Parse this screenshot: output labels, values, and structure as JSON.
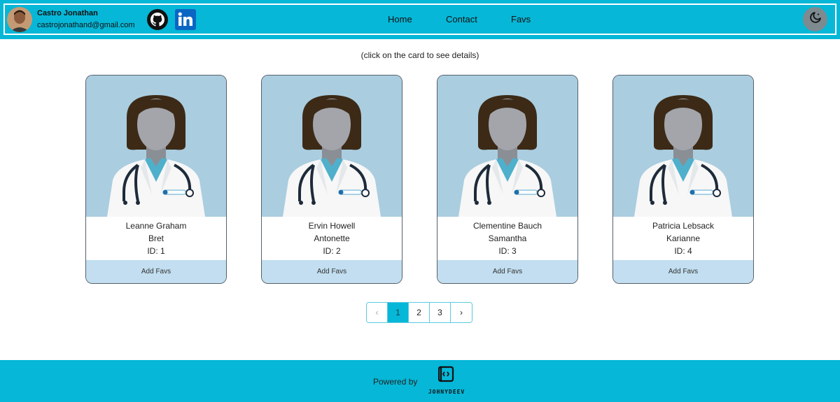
{
  "header": {
    "profile_name": "Castro Jonathan",
    "profile_email": "castrojonathand@gmail.com",
    "social": [
      {
        "name": "github-icon"
      },
      {
        "name": "linkedin-icon"
      }
    ],
    "nav": [
      "Home",
      "Contact",
      "Favs"
    ],
    "theme_toggle_icon": "moon-icon"
  },
  "main": {
    "hint": "(click on the card to see details)",
    "cards": [
      {
        "name": "Leanne Graham",
        "username": "Bret",
        "id": "ID: 1",
        "action": "Add Favs"
      },
      {
        "name": "Ervin Howell",
        "username": "Antonette",
        "id": "ID: 2",
        "action": "Add Favs"
      },
      {
        "name": "Clementine Bauch",
        "username": "Samantha",
        "id": "ID: 3",
        "action": "Add Favs"
      },
      {
        "name": "Patricia Lebsack",
        "username": "Karianne",
        "id": "ID: 4",
        "action": "Add Favs"
      }
    ]
  },
  "pagination": {
    "prev": "‹",
    "pages": [
      "1",
      "2",
      "3"
    ],
    "current": "1",
    "next": "›"
  },
  "footer": {
    "powered_by": "Powered by",
    "brand": "JOHNYDEEV"
  },
  "colors": {
    "accent": "#06b7d7",
    "card_image_bg": "#aacde0",
    "card_action_bg": "#c2def0",
    "theme_toggle_bg": "#7d8b91"
  }
}
